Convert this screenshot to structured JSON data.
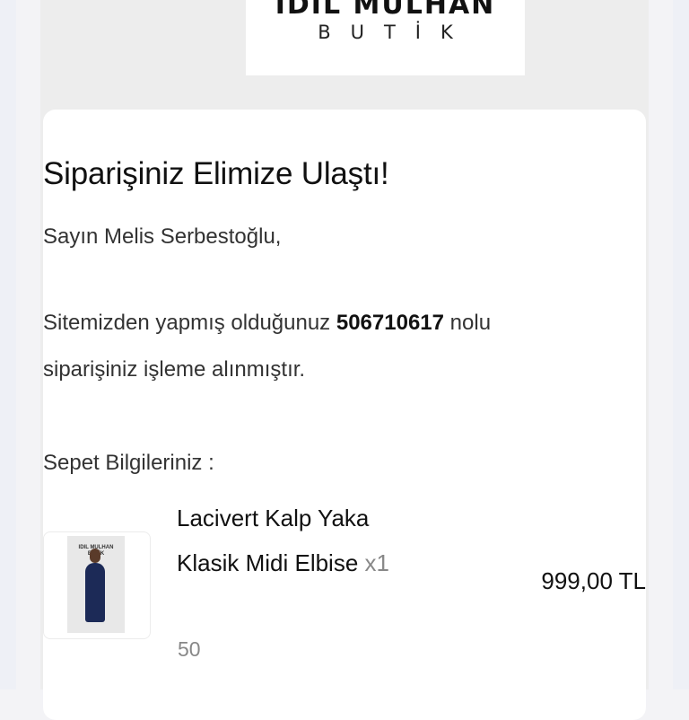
{
  "logo": {
    "title": "IDIL MULHAN",
    "subtitle": "BUTİK"
  },
  "email": {
    "heading": "Siparişiniz Elimize Ulaştı!",
    "greeting": "Sayın Melis Serbestoğlu,",
    "message_prefix": "Sitemizden yapmış olduğunuz",
    "order_number": "506710617",
    "message_suffix": "nolu",
    "message_line2": "siparişiniz işleme alınmıştır.",
    "cart_label": "Sepet Bilgileriniz :"
  },
  "cart": {
    "items": [
      {
        "name": "Lacivert Kalp Yaka Klasik Midi Elbise",
        "quantity": "x1",
        "variant": "50",
        "price": "999,00 TL",
        "thumbnail_logo": "IDIL MULHAN BUTİK"
      }
    ]
  },
  "colors": {
    "page_bg": "#ededed",
    "card_bg": "#ffffff",
    "dress": "#1c2a57"
  }
}
